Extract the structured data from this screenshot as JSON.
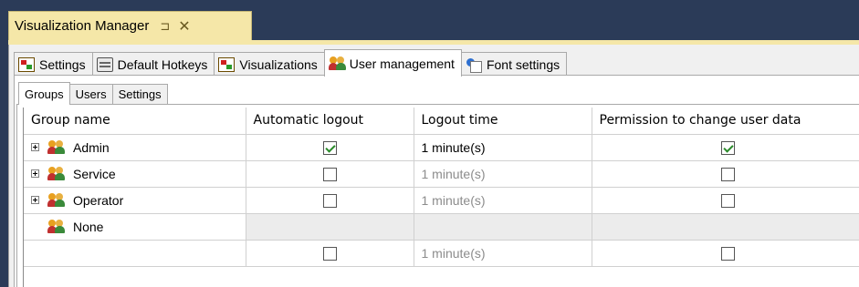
{
  "window": {
    "title": "Visualization Manager",
    "pin_glyph": "⊐",
    "close_glyph": "✕"
  },
  "outer_tabs": [
    {
      "label": "Settings",
      "icon": "window-icon"
    },
    {
      "label": "Default Hotkeys",
      "icon": "keyboard-icon"
    },
    {
      "label": "Visualizations",
      "icon": "window-icon"
    },
    {
      "label": "User management",
      "icon": "users-icon",
      "active": true
    },
    {
      "label": "Font settings",
      "icon": "font-icon"
    }
  ],
  "inner_tabs": [
    {
      "label": "Groups",
      "active": true
    },
    {
      "label": "Users"
    },
    {
      "label": "Settings"
    }
  ],
  "grid": {
    "columns": [
      "Group name",
      "Automatic logout",
      "Logout time",
      "Permission to change user data"
    ],
    "rows": [
      {
        "name": "Admin",
        "expandable": true,
        "auto_logout": true,
        "logout_time": "1 minute(s)",
        "time_enabled": true,
        "permission": true
      },
      {
        "name": "Service",
        "expandable": true,
        "auto_logout": false,
        "logout_time": "1 minute(s)",
        "time_enabled": false,
        "permission": false
      },
      {
        "name": "Operator",
        "expandable": true,
        "auto_logout": false,
        "logout_time": "1 minute(s)",
        "time_enabled": false,
        "permission": false
      },
      {
        "name": "None",
        "expandable": false,
        "auto_logout": null,
        "logout_time": "",
        "time_enabled": false,
        "permission": null
      },
      {
        "name": "",
        "expandable": false,
        "auto_logout": false,
        "logout_time": "1 minute(s)",
        "time_enabled": false,
        "permission": false
      }
    ]
  },
  "colors": {
    "doc_tab": "#f5e7a8",
    "frame": "#2b3b58",
    "check": "#2a8a2a"
  }
}
